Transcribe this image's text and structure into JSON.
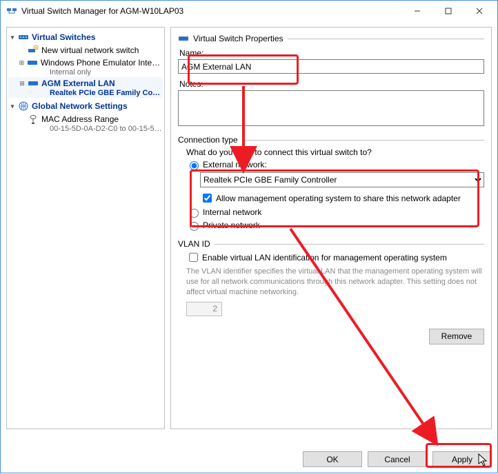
{
  "window": {
    "title": "Virtual Switch Manager for AGM-W10LAP03"
  },
  "tree": {
    "section1_label": "Virtual Switches",
    "new_switch_label": "New virtual network switch",
    "wpe_label": "Windows Phone Emulator Internal …",
    "wpe_sub": "Internal only",
    "agm_label": "AGM External LAN",
    "agm_sub": "Realtek PCIe GBE Family Cont…",
    "section2_label": "Global Network Settings",
    "mac_label": "MAC Address Range",
    "mac_sub": "00-15-5D-0A-D2-C0 to 00-15-5D-0…"
  },
  "props": {
    "group_title": "Virtual Switch Properties",
    "name_label": "Name:",
    "name_value": "AGM External LAN",
    "notes_label": "Notes:",
    "notes_value": "",
    "conn_title": "Connection type",
    "conn_prompt": "What do you want to connect this virtual switch to?",
    "ext_label": "External network:",
    "adapter_selected": "Realtek PCIe GBE Family Controller",
    "share_label": "Allow management operating system to share this network adapter",
    "int_label": "Internal network",
    "priv_label": "Private network",
    "vlan_title": "VLAN ID",
    "vlan_check_label": "Enable virtual LAN identification for management operating system",
    "vlan_desc": "The VLAN identifier specifies the virtual LAN that the management operating system will use for all network communications through this network adapter. This setting does not affect virtual machine networking.",
    "vlan_value": "2",
    "remove_label": "Remove"
  },
  "buttons": {
    "ok": "OK",
    "cancel": "Cancel",
    "apply": "Apply"
  }
}
